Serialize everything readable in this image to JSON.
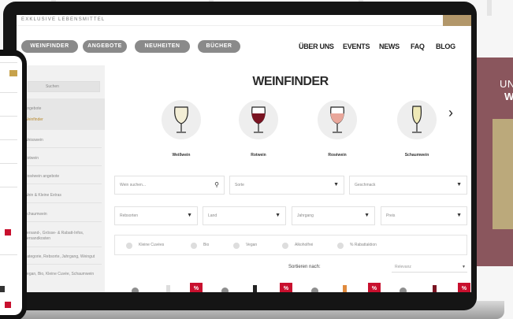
{
  "header": {
    "brand": "EXKLUSIVE LEBENSMITTEL",
    "pills": [
      "WEINFINDER",
      "ANGEBOTE",
      "NEUHEITEN",
      "BÜCHER"
    ],
    "links": [
      "ÜBER UNS",
      "EVENTS",
      "NEWS",
      "FAQ",
      "BLOG"
    ]
  },
  "sidebar": {
    "search_placeholder": "Suchen",
    "items": [
      "Angebote",
      "Weinfinder",
      "Weisswein",
      "Rotwein",
      "Roséwein angebote",
      "Wein & Kleine Extras",
      "Schaumwein",
      "Versand-, Grösse- & Rabatt-Infos, Versandkosten",
      "Kategorie, Rebsorte, Jahrgang, Weingut",
      "Vegan, Bio, Kleine Cuvée, Schaumwein"
    ]
  },
  "main": {
    "title": "WEINFINDER",
    "wine_types": [
      {
        "label": "Weißwein",
        "color": "#f3eed6"
      },
      {
        "label": "Rotwein",
        "color": "#7a1422"
      },
      {
        "label": "Roséwein",
        "color": "#e9a79b"
      },
      {
        "label": "Schaumwein",
        "color": "#efe9b7"
      }
    ],
    "next_arrow": "›",
    "search_placeholder": "Wein suchen...",
    "selects_row1": [
      "Sorte",
      "Geschmack"
    ],
    "selects_row2": [
      "Rebsorten",
      "Land",
      "Jahrgang",
      "Preis"
    ],
    "checkboxes": [
      "Kleine Cuvées",
      "Bio",
      "Vegan",
      "Alkoholfrei",
      "% Rabattaktion"
    ],
    "sort_label": "Sortieren nach:",
    "sort_value": "Relevanz",
    "badge": "%"
  },
  "promo": {
    "line1": "UN",
    "line2": "W"
  },
  "tablet": {
    "colors": {
      "gold": "#c7a24b",
      "red": "#c8102e"
    }
  },
  "colors": {
    "accent": "#b2976a",
    "sale": "#c8102e",
    "promo_bg": "#8a565d"
  }
}
